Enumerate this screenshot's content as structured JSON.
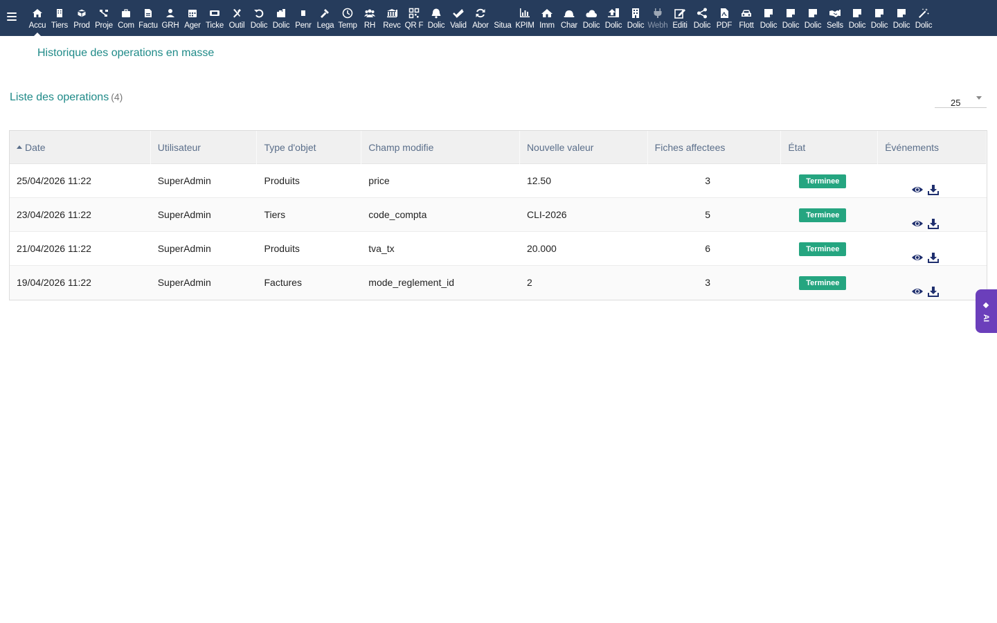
{
  "topbar": {
    "items": [
      {
        "label": "Accu",
        "icon": "home-icon",
        "active": true
      },
      {
        "label": "Tiers",
        "icon": "building-icon"
      },
      {
        "label": "Prod",
        "icon": "cube-icon"
      },
      {
        "label": "Proje",
        "icon": "sitemap-icon"
      },
      {
        "label": "Com",
        "icon": "briefcase-icon"
      },
      {
        "label": "Factu",
        "icon": "file-invoice-icon"
      },
      {
        "label": "GRH",
        "icon": "user-tie-icon"
      },
      {
        "label": "Ager",
        "icon": "calendar-icon"
      },
      {
        "label": "Ticke",
        "icon": "ticket-icon"
      },
      {
        "label": "Outil",
        "icon": "tools-icon"
      },
      {
        "label": "Dolic",
        "icon": "undo-icon"
      },
      {
        "label": "Dolic",
        "icon": "toolbox-icon"
      },
      {
        "label": "Penr",
        "icon": "file-icon"
      },
      {
        "label": "Lega",
        "icon": "gavel-icon"
      },
      {
        "label": "Temp",
        "icon": "clock-icon"
      },
      {
        "label": "RH",
        "icon": "users-icon"
      },
      {
        "label": "Revc",
        "icon": "bank-icon"
      },
      {
        "label": "QR F",
        "icon": "qrcode-icon"
      },
      {
        "label": "Dolic",
        "icon": "bell-icon"
      },
      {
        "label": "Valid",
        "icon": "check-double-icon"
      },
      {
        "label": "Abor",
        "icon": "sync-icon"
      },
      {
        "label": "Situa",
        "icon": "blank-icon"
      },
      {
        "label": "KPIM",
        "icon": "chart-bar-icon"
      },
      {
        "label": "Imm",
        "icon": "house-icon"
      },
      {
        "label": "Char",
        "icon": "helmet-icon"
      },
      {
        "label": "Dolic",
        "icon": "cloud-icon"
      },
      {
        "label": "Dolic",
        "icon": "upload-icon"
      },
      {
        "label": "Dolic",
        "icon": "office-building-icon"
      },
      {
        "label": "Webh",
        "icon": "plug-icon",
        "dim": true
      },
      {
        "label": "Editi",
        "icon": "edit-icon"
      },
      {
        "label": "Dolic",
        "icon": "share-icon"
      },
      {
        "label": "PDF",
        "icon": "file-pdf-icon"
      },
      {
        "label": "Flott",
        "icon": "car-icon"
      },
      {
        "label": "Dolic",
        "icon": "note-icon"
      },
      {
        "label": "Dolic",
        "icon": "note-icon"
      },
      {
        "label": "Dolic",
        "icon": "note-icon"
      },
      {
        "label": "Sells",
        "icon": "handshake-icon"
      },
      {
        "label": "Dolic",
        "icon": "note-icon"
      },
      {
        "label": "Dolic",
        "icon": "note-icon"
      },
      {
        "label": "Dolic",
        "icon": "note-icon"
      },
      {
        "label": "Dolic",
        "icon": "magic-wand-icon"
      }
    ]
  },
  "page": {
    "title": "Historique des operations en masse",
    "list_title": "Liste des operations",
    "list_count": "(4)",
    "limit": "25"
  },
  "table": {
    "headers": [
      "Date",
      "Utilisateur",
      "Type d'objet",
      "Champ modifie",
      "Nouvelle valeur",
      "Fiches affectees",
      "État",
      "Événements"
    ],
    "rows": [
      {
        "date": "25/04/2026 11:22",
        "user": "SuperAdmin",
        "type": "Produits",
        "field": "price",
        "value": "12.50",
        "count": "3",
        "status": "Terminee"
      },
      {
        "date": "23/04/2026 11:22",
        "user": "SuperAdmin",
        "type": "Tiers",
        "field": "code_compta",
        "value": "CLI-2026",
        "count": "5",
        "status": "Terminee"
      },
      {
        "date": "21/04/2026 11:22",
        "user": "SuperAdmin",
        "type": "Produits",
        "field": "tva_tx",
        "value": "20.000",
        "count": "6",
        "status": "Terminee"
      },
      {
        "date": "19/04/2026 11:22",
        "user": "SuperAdmin",
        "type": "Factures",
        "field": "mode_reglement_id",
        "value": "2",
        "count": "3",
        "status": "Terminee"
      }
    ]
  },
  "ai_tab": {
    "label": "AI"
  },
  "colors": {
    "topbar": "#263c5c",
    "accent": "#1f8a88",
    "badge": "#25a580",
    "ai": "#6b3fbb",
    "icon": "#263c8a"
  }
}
